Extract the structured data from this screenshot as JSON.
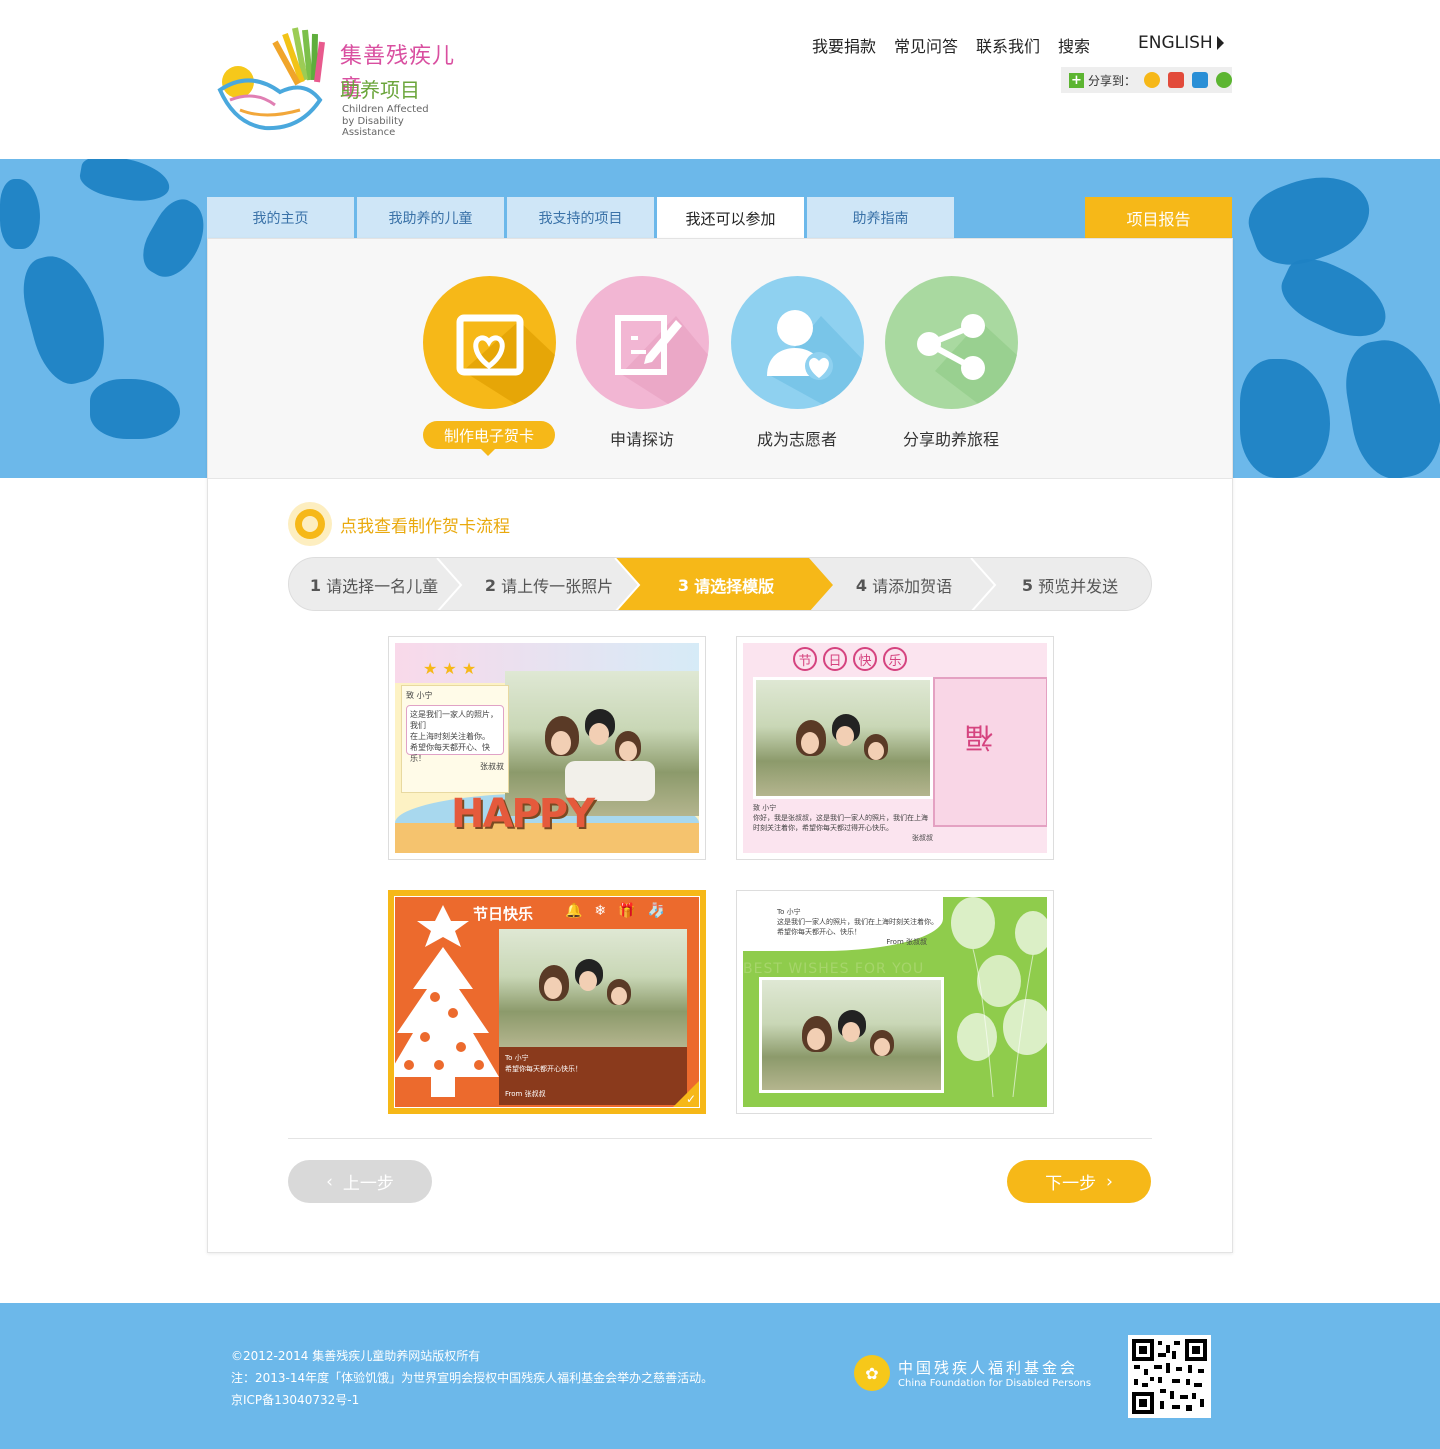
{
  "header": {
    "logo_cn_line1": "集善残疾儿童",
    "logo_cn_line2": "助养项目",
    "logo_en_line1": "Children Affected",
    "logo_en_line2": "by Disability Assistance",
    "nav": [
      "我要捐款",
      "常见问答",
      "联系我们",
      "搜索"
    ],
    "english_label": "ENGLISH",
    "share_label": "分享到："
  },
  "tabs": [
    "我的主页",
    "我助养的儿童",
    "我支持的项目",
    "我还可以参加",
    "助养指南"
  ],
  "active_tab_index": 3,
  "report_label": "项目报告",
  "actions": [
    {
      "label": "制作电子贺卡",
      "color": "#f6b818",
      "icon": "card-heart-icon"
    },
    {
      "label": "申请探访",
      "color": "#f2b6d3",
      "icon": "edit-form-icon"
    },
    {
      "label": "成为志愿者",
      "color": "#8fd1f0",
      "icon": "volunteer-icon"
    },
    {
      "label": "分享助养旅程",
      "color": "#a9d9a0",
      "icon": "share-icon"
    }
  ],
  "flow_link": "点我查看制作贺卡流程",
  "steps": [
    {
      "num": "1",
      "label": "请选择一名儿童"
    },
    {
      "num": "2",
      "label": "请上传一张照片"
    },
    {
      "num": "3",
      "label": "请选择模版"
    },
    {
      "num": "4",
      "label": "请添加贺语"
    },
    {
      "num": "5",
      "label": "预览并发送"
    }
  ],
  "current_step": 3,
  "templates": {
    "t1": {
      "to": "致 小宁",
      "msg1": "这是我们一家人的照片，我们",
      "msg2": "在上海时刻关注着你。",
      "msg3": "希望你每天都开心、快乐！",
      "from": "张叔叔",
      "word": "HAPPY"
    },
    "t2": {
      "title": [
        "节",
        "日",
        "快",
        "乐"
      ],
      "to": "致 小宁",
      "msg1": "你好，我是张叔叔，这是我们一家人的照片，我们在上海",
      "msg2": "时刻关注着你，希望你每天都过得开心快乐。",
      "from": "张叔叔"
    },
    "t3": {
      "title": "节日快乐",
      "to": "To  小宁",
      "msg": "希望你每天都开心快乐！",
      "from": "From  张叔叔"
    },
    "t4": {
      "to": "To  小宁",
      "msg1": "这是我们一家人的照片，我们在上海时刻关注着你。",
      "msg2": "希望你每天都开心、快乐！",
      "from": "From  张叔叔",
      "watermark": "BEST WISHES FOR YOU"
    }
  },
  "selected_template": 3,
  "prev_label": "上一步",
  "next_label": "下一步",
  "footer": {
    "copyright": "©2012-2014 集善残疾儿童助养网站版权所有",
    "note": "注：2013-14年度「体验饥饿」为世界宣明会授权中国残疾人福利基金会举办之慈善活动。",
    "icp": "京ICP备13040732号-1",
    "org_cn": "中国残疾人福利基金会",
    "org_en": "China Foundation for Disabled Persons"
  }
}
